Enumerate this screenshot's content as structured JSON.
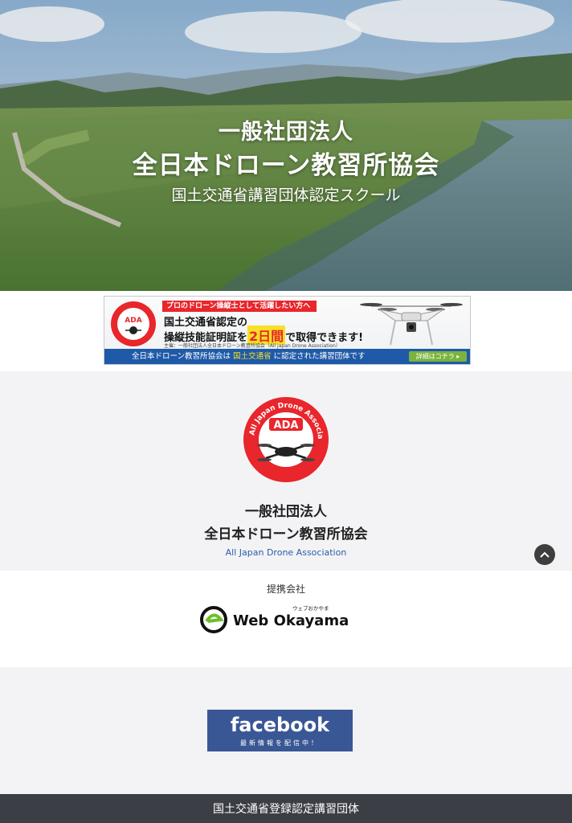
{
  "hero": {
    "title_line1": "一般社団法人",
    "title_line2": "全日本ドローン教習所協会",
    "subtitle": "国土交通省講習団体認定スクール"
  },
  "banner": {
    "tag": "プロのドローン操縦士として活躍したい方へ",
    "line1": "国土交通省認定の",
    "line2_pre": "操縦技能証明証を",
    "line2_highlight": "2日間",
    "line2_post": "で取得できます!",
    "note": "主催：一般社団法人全日本ドローン教習所協会（All japan Drone Association）",
    "bar_pre": "全日本ドローン教習所協会は",
    "bar_highlight": "国土交通省",
    "bar_post": "に認定された講習団体です",
    "button": "詳細はコチラ ▸",
    "logo_text": "ADA",
    "logo_ring": "All Japan Drone Association"
  },
  "association": {
    "logo_text": "ADA",
    "logo_ring": "All Japan Drone Association",
    "name_line1": "一般社団法人",
    "name_line2": "全日本ドローン教習所協会",
    "name_en": "All Japan Drone Association"
  },
  "partner": {
    "label": "提携会社",
    "name": "Web Okayama",
    "kana": "ウェブおかやま"
  },
  "facebook": {
    "word": "facebook",
    "sub": "最新情報を配信中！"
  },
  "footer": {
    "text": "国土交通省登録認定講習団体"
  },
  "icons": {
    "scroll_top": "chevron-up-icon"
  },
  "colors": {
    "brand_red": "#e8262b",
    "banner_blue": "#1f5aa8",
    "facebook_blue": "#3a5795",
    "footer_bg": "#3b3e45",
    "english_name": "#2a5da8"
  }
}
